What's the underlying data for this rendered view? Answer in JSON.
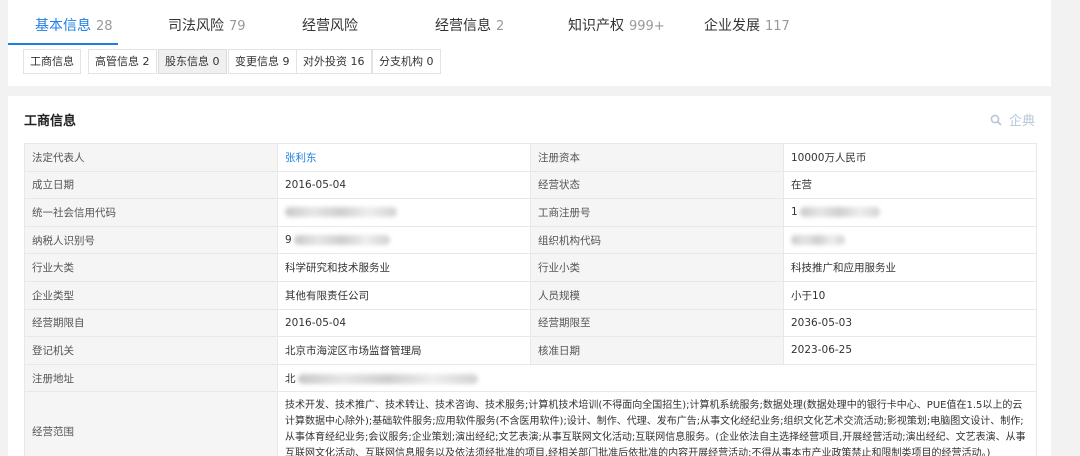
{
  "tabs": [
    {
      "label": "基本信息",
      "count": "28",
      "active": true
    },
    {
      "label": "司法风险",
      "count": "79",
      "active": false
    },
    {
      "label": "经营风险",
      "count": "",
      "active": false
    },
    {
      "label": "经营信息",
      "count": "2",
      "active": false
    },
    {
      "label": "知识产权",
      "count": "999+",
      "active": false
    },
    {
      "label": "企业发展",
      "count": "117",
      "active": false
    }
  ],
  "subtabs": [
    {
      "label": "工商信息",
      "selected": false
    },
    {
      "label": "高管信息 2",
      "selected": false
    },
    {
      "label": "股东信息 0",
      "selected": true
    },
    {
      "label": "变更信息 9",
      "selected": false
    },
    {
      "label": "对外投资 16",
      "selected": false
    },
    {
      "label": "分支机构 0",
      "selected": false
    }
  ],
  "section": {
    "title": "工商信息",
    "brand": "企典",
    "brand_icon": "search-icon"
  },
  "rows": [
    {
      "l1": "法定代表人",
      "v1": "张利东",
      "l2": "注册资本",
      "v2": "10000万人民币"
    },
    {
      "l1": "成立日期",
      "v1": "2016-05-04",
      "l2": "经营状态",
      "v2": "在营"
    },
    {
      "l1": "统一社会信用代码",
      "v1": "",
      "l2": "工商注册号",
      "v2": "1"
    },
    {
      "l1": "纳税人识别号",
      "v1": "9",
      "l2": "组织机构代码",
      "v2": ""
    },
    {
      "l1": "行业大类",
      "v1": "科学研究和技术服务业",
      "l2": "行业小类",
      "v2": "科技推广和应用服务业"
    },
    {
      "l1": "企业类型",
      "v1": "其他有限责任公司",
      "l2": "人员规模",
      "v2": "小于10"
    },
    {
      "l1": "经营期限自",
      "v1": "2016-05-04",
      "l2": "经营期限至",
      "v2": "2036-05-03"
    },
    {
      "l1": "登记机关",
      "v1": "北京市海淀区市场监督管理局",
      "l2": "核准日期",
      "v2": "2023-06-25"
    }
  ],
  "address": {
    "label": "注册地址",
    "value": "北"
  },
  "scope": {
    "label": "经营范围",
    "value": "技术开发、技术推广、技术转让、技术咨询、技术服务;计算机技术培训(不得面向全国招生);计算机系统服务;数据处理(数据处理中的银行卡中心、PUE值在1.5以上的云计算数据中心除外);基础软件服务;应用软件服务(不含医用软件);设计、制作、代理、发布广告;从事文化经纪业务;组织文化艺术交流活动;影视策划;电脑图文设计、制作;从事体育经纪业务;会议服务;企业策划;演出经纪;文艺表演;从事互联网文化活动;互联网信息服务。(企业依法自主选择经营项目,开展经营活动;演出经纪、文艺表演、从事互联网文化活动、互联网信息服务以及依法须经批准的项目,经相关部门批准后依批准的内容开展经营活动;不得从事本市产业政策禁止和限制类项目的经营活动。)"
  },
  "colors": {
    "accent": "#1e7ee6",
    "label_bg": "#f5f5f5",
    "border": "#e8e8e8"
  }
}
